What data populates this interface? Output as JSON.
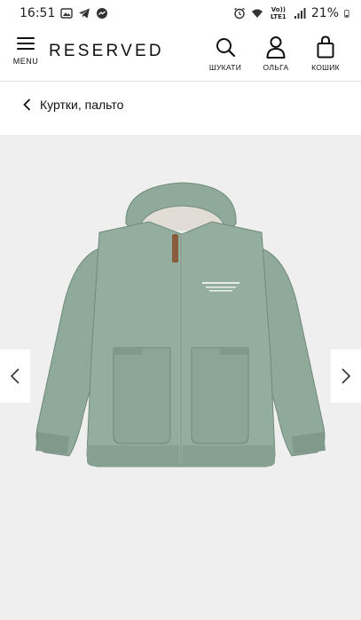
{
  "status_bar": {
    "time": "16:51",
    "network": "Vo)) LTE1",
    "battery": "21%"
  },
  "header": {
    "menu_label": "MENU",
    "logo": "RESERVED",
    "search_label": "ШУКАТИ",
    "account_label": "ОЛЬГА",
    "cart_label": "КОШИК"
  },
  "breadcrumb": {
    "label": "Куртки, пальто"
  },
  "gallery": {
    "product_color": "#8fa99a",
    "lining_color": "#e2ddd4",
    "background": "#efefef"
  }
}
